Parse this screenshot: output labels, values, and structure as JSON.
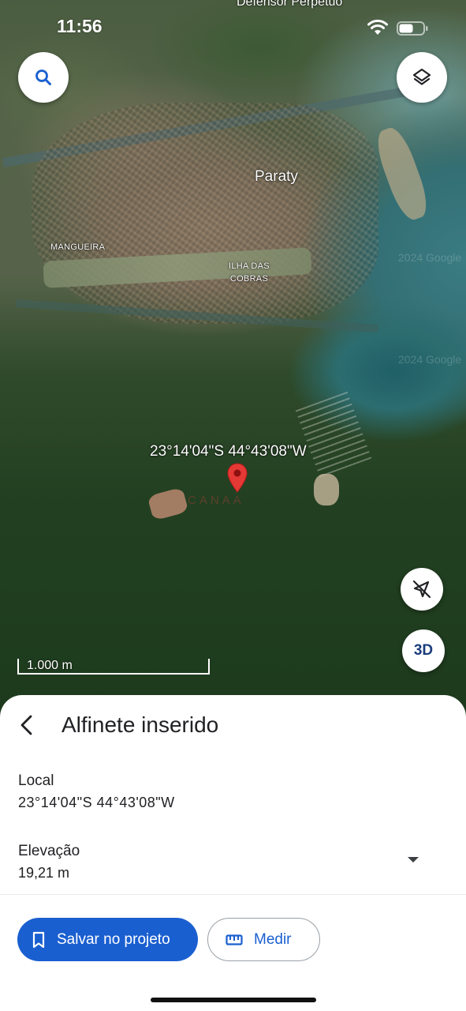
{
  "status_bar": {
    "time": "11:56",
    "icons": [
      "wifi-icon",
      "battery-icon"
    ]
  },
  "map": {
    "labels": {
      "top_place": "Defensor Perpétuo",
      "city": "Paraty",
      "neighborhood_1": "MANGUEIRA",
      "neighborhood_2_line1": "ILHA DAS",
      "neighborhood_2_line2": "COBRAS",
      "pin_coordinates": "23°14'04\"S 44°43'08\"W"
    },
    "watermarks": {
      "google_1": "2024 Google",
      "google_2": "2024 Google",
      "overlay": "CANAA"
    },
    "scale_text": "1.000 m",
    "buttons": {
      "search_icon": "search-icon",
      "layers_icon": "layers-icon",
      "compass_icon": "compass-off-icon",
      "view_3d_label": "3D"
    },
    "pin_color": "#e53935"
  },
  "sheet": {
    "title": "Alfinete inserido",
    "local_label": "Local",
    "local_value": "23°14'04\"S 44°43'08\"W",
    "elevation_label": "Elevação",
    "elevation_value": "19,21 m",
    "save_label": "Salvar no projeto",
    "measure_label": "Medir"
  },
  "colors": {
    "primary": "#1a5fd0",
    "text": "#202124"
  }
}
